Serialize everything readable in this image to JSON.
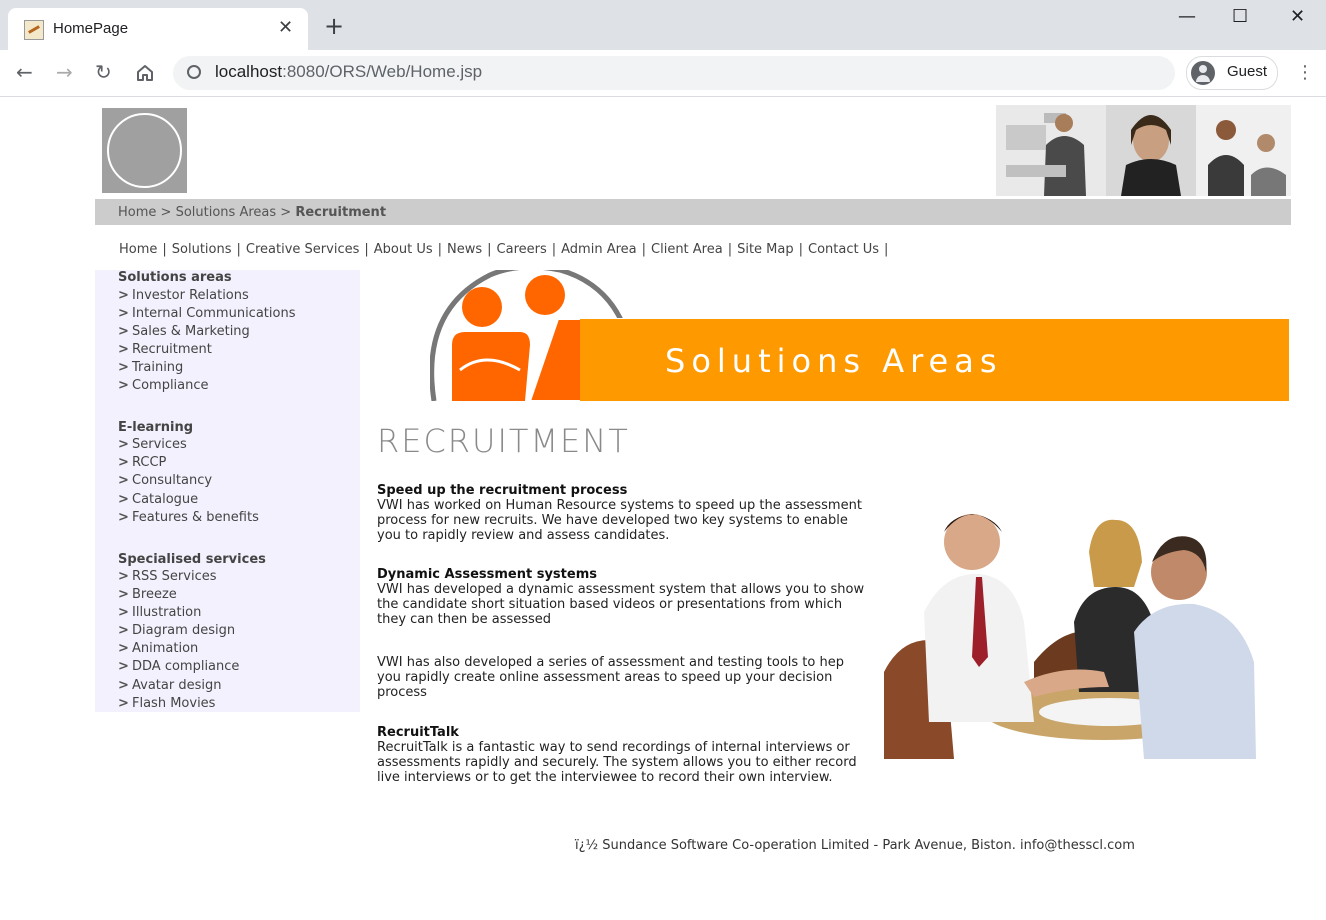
{
  "browser": {
    "tab_title": "HomePage",
    "tab_close": "✕",
    "new_tab": "+",
    "url_host": "localhost",
    "url_rest": ":8080/ORS/Web/Home.jsp",
    "profile": "Guest",
    "window_controls": [
      "—",
      "☐",
      "✕"
    ]
  },
  "breadcrumb": {
    "items": [
      "Home",
      "Solutions Areas"
    ],
    "separator": ">",
    "current": "Recruitment"
  },
  "topnav": [
    "Home",
    "Solutions",
    "Creative Services",
    "About Us",
    "News",
    "Careers",
    "Admin Area",
    "Client Area",
    "Site Map",
    "Contact Us"
  ],
  "sidebar": {
    "sections": [
      {
        "title": "Solutions areas",
        "items": [
          "Investor Relations",
          "Internal Communications",
          "Sales & Marketing",
          "Recruitment",
          "Training",
          "Compliance"
        ]
      },
      {
        "title": "E-learning",
        "items": [
          "Services",
          "RCCP",
          "Consultancy",
          "Catalogue",
          "Features & benefits"
        ]
      },
      {
        "title": "Specialised services",
        "items": [
          "RSS Services",
          "Breeze",
          "Illustration",
          "Diagram design",
          "Animation",
          "DDA compliance",
          "Avatar design",
          "Flash Movies"
        ]
      }
    ]
  },
  "banner": {
    "title": "Solutions Areas"
  },
  "page_heading": "RECRUITMENT",
  "content": [
    {
      "heading": "Speed up the recruitment process",
      "body": "VWI has worked on Human Resource systems to speed up the assessment process for new recruits. We have developed two key systems to enable you to rapidly review and assess candidates."
    },
    {
      "heading": "Dynamic Assessment systems",
      "body": "VWI has developed a dynamic assessment system that allows you to show the candidate short situation based videos or presentations from which they can then be assessed"
    },
    {
      "heading": "",
      "body": "VWI has also developed a series of assessment and testing tools to hep you rapidly create online assessment areas to speed up your decision process"
    },
    {
      "heading": "RecruitTalk",
      "body": "RecruitTalk is a fantastic way to send recordings of internal interviews or assessments rapidly and securely. The system allows you to either record live interviews or to get the interviewee to record their own interview."
    }
  ],
  "footer": "ï¿½ Sundance Software Co-operation Limited - Park Avenue, Biston. info@thesscl.com",
  "colors": {
    "banner_orange": "#ff9900",
    "figure_orange": "#ff6600",
    "sidebar_bg": "#f3f1fd",
    "breadcrumb_bg": "#cccccc"
  }
}
